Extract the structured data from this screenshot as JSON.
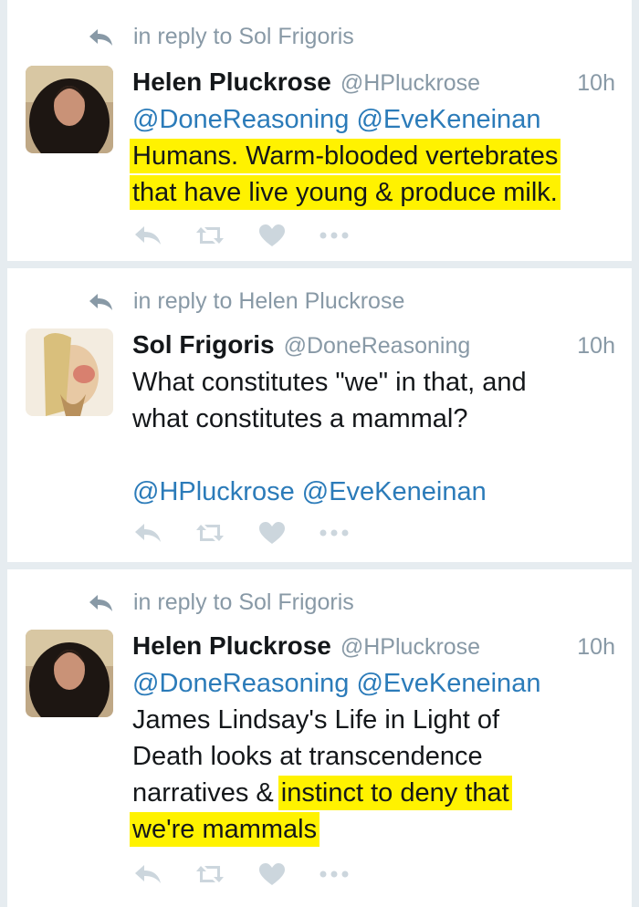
{
  "tweets": [
    {
      "reply_to": "in reply to Sol Frigoris",
      "name": "Helen Pluckrose",
      "handle": "@HPluckrose",
      "time": "10h",
      "mentions": "@DoneReasoning @EveKeneinan",
      "body_plain": "",
      "body_highlight_1": "Humans. Warm-blooded vertebrates",
      "body_highlight_2": "that have live young & produce milk."
    },
    {
      "reply_to": "in reply to Helen Pluckrose",
      "name": "Sol Frigoris",
      "handle": "@DoneReasoning",
      "time": "10h",
      "body_line_1": "What constitutes \"we\" in that, and",
      "body_line_2": "what constitutes a mammal?",
      "mentions": "@HPluckrose @EveKeneinan"
    },
    {
      "reply_to": "in reply to Sol Frigoris",
      "name": "Helen Pluckrose",
      "handle": "@HPluckrose",
      "time": "10h",
      "mentions": "@DoneReasoning @EveKeneinan",
      "body_line_1": "James Lindsay's Life in Light of",
      "body_line_2": "Death looks at transcendence",
      "body_line_3_plain": "narratives & ",
      "body_line_3_highlight": "instinct to deny that",
      "body_line_4_highlight": "we're mammals"
    }
  ],
  "icons": {
    "reply": "reply-arrow-icon",
    "retweet": "retweet-icon",
    "like": "heart-icon",
    "more": "more-dots-icon"
  },
  "colors": {
    "link": "#2b7bb9",
    "muted": "#8899a6",
    "highlight": "#fff200",
    "icon": "#ccd6dd"
  }
}
